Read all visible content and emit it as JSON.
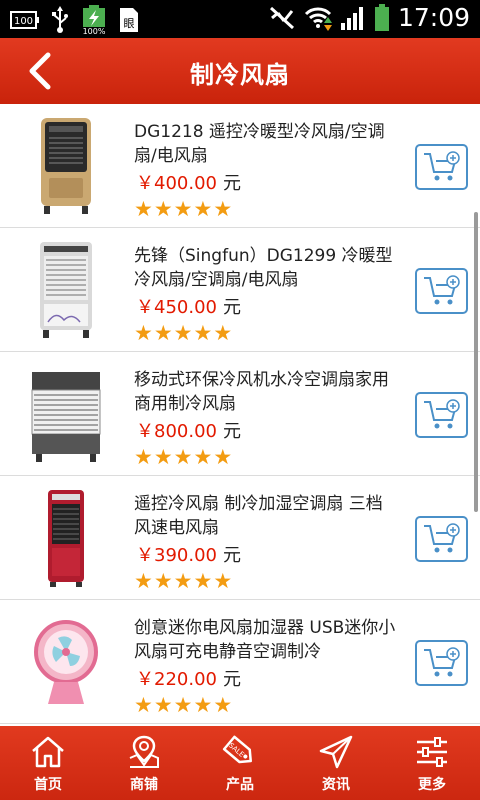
{
  "status_bar": {
    "battery_left_label": "100",
    "battery_percent": "100%",
    "time": "17:09",
    "icons": [
      "battery-icon",
      "usb-icon",
      "battery-charging-icon",
      "app-notification-icon",
      "mute-icon",
      "wifi-icon",
      "signal-icon",
      "battery-full-icon"
    ]
  },
  "header": {
    "title": "制冷风扇",
    "back_icon": "chevron-left-icon"
  },
  "products": [
    {
      "name": "DG1218 遥控冷暖型冷风扇/空调扇/电风扇",
      "price": "￥400.00",
      "unit": "元",
      "rating": 5,
      "cart_icon": "add-to-cart-icon"
    },
    {
      "name": "先锋（Singfun）DG1299 冷暖型冷风扇/空调扇/电风扇",
      "price": "￥450.00",
      "unit": "元",
      "rating": 5,
      "cart_icon": "add-to-cart-icon"
    },
    {
      "name": "移动式环保冷风机水冷空调扇家用商用制冷风扇",
      "price": "￥800.00",
      "unit": "元",
      "rating": 5,
      "cart_icon": "add-to-cart-icon"
    },
    {
      "name": "遥控冷风扇 制冷加湿空调扇 三档风速电风扇",
      "price": "￥390.00",
      "unit": "元",
      "rating": 5,
      "cart_icon": "add-to-cart-icon"
    },
    {
      "name": "创意迷你电风扇加湿器 USB迷你小风扇可充电静音空调制冷",
      "price": "￥220.00",
      "unit": "元",
      "rating": 5,
      "cart_icon": "add-to-cart-icon"
    }
  ],
  "tabbar": {
    "items": [
      {
        "label": "首页",
        "icon": "home-icon"
      },
      {
        "label": "商铺",
        "icon": "map-pin-icon"
      },
      {
        "label": "产品",
        "icon": "sale-tag-icon"
      },
      {
        "label": "资讯",
        "icon": "send-icon"
      },
      {
        "label": "更多",
        "icon": "settings-sliders-icon"
      }
    ]
  },
  "colors": {
    "header_bg": "#d92e14",
    "price": "#e21a00",
    "star": "#f39c12",
    "cart_border": "#4a90c8"
  }
}
